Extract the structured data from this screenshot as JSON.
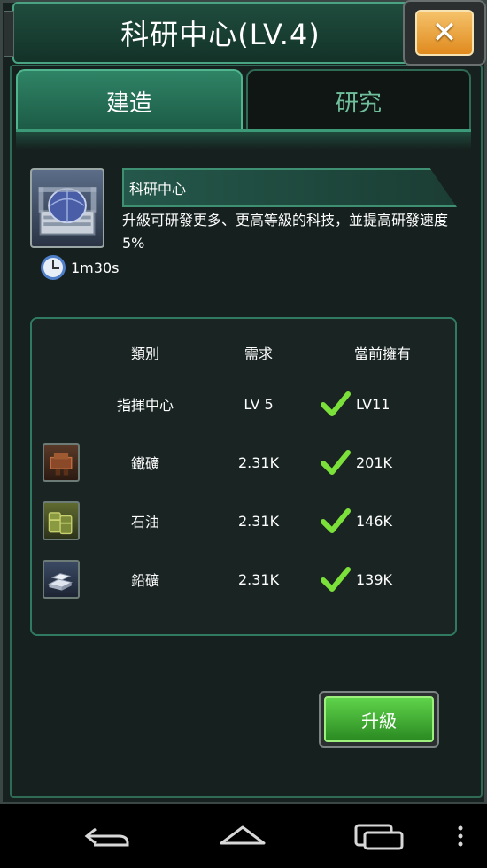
{
  "header": {
    "title": "科研中心(LV.4)",
    "close_icon": "close-icon"
  },
  "tabs": [
    {
      "label": "建造",
      "active": true
    },
    {
      "label": "研究",
      "active": false
    }
  ],
  "building": {
    "name": "科研中心",
    "description": "升級可研發更多、更高等級的科技，並提高研發速度5%",
    "build_time": "1m30s",
    "icon": "research-center-icon"
  },
  "requirements": {
    "headers": {
      "category": "類別",
      "required": "需求",
      "owned": "當前擁有"
    },
    "rows": [
      {
        "category": "指揮中心",
        "required": "LV 5",
        "owned": "LV11",
        "met": true,
        "icon": null
      },
      {
        "category": "鐵礦",
        "required": "2.31K",
        "owned": "201K",
        "met": true,
        "icon": "iron-ore-icon"
      },
      {
        "category": "石油",
        "required": "2.31K",
        "owned": "146K",
        "met": true,
        "icon": "oil-barrel-icon"
      },
      {
        "category": "鉛礦",
        "required": "2.31K",
        "owned": "139K",
        "met": true,
        "icon": "lead-ingot-icon"
      }
    ]
  },
  "actions": {
    "upgrade_label": "升級"
  },
  "colors": {
    "accent_green": "#4aa382",
    "check_green": "#7be03a",
    "close_orange": "#e08a1e"
  }
}
